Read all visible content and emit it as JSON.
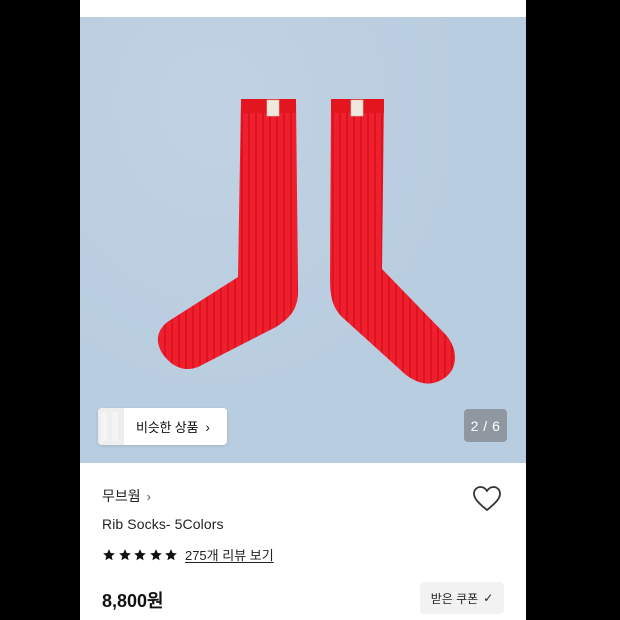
{
  "gallery": {
    "similar_label": "비슷한 상품",
    "counter": "2 / 6",
    "product_color": "#f01f2e",
    "background_color": "#b9cde0"
  },
  "product": {
    "brand": "무브웜",
    "title": "Rib Socks- 5Colors",
    "rating_stars": 5,
    "review_link": "275개 리뷰 보기",
    "price": "8,800원",
    "coupon_label": "받은 쿠폰"
  },
  "icons": {
    "heart": "heart-outline-icon",
    "chevron": "chevron-right-icon",
    "check": "check-icon",
    "star": "star-filled-icon"
  }
}
